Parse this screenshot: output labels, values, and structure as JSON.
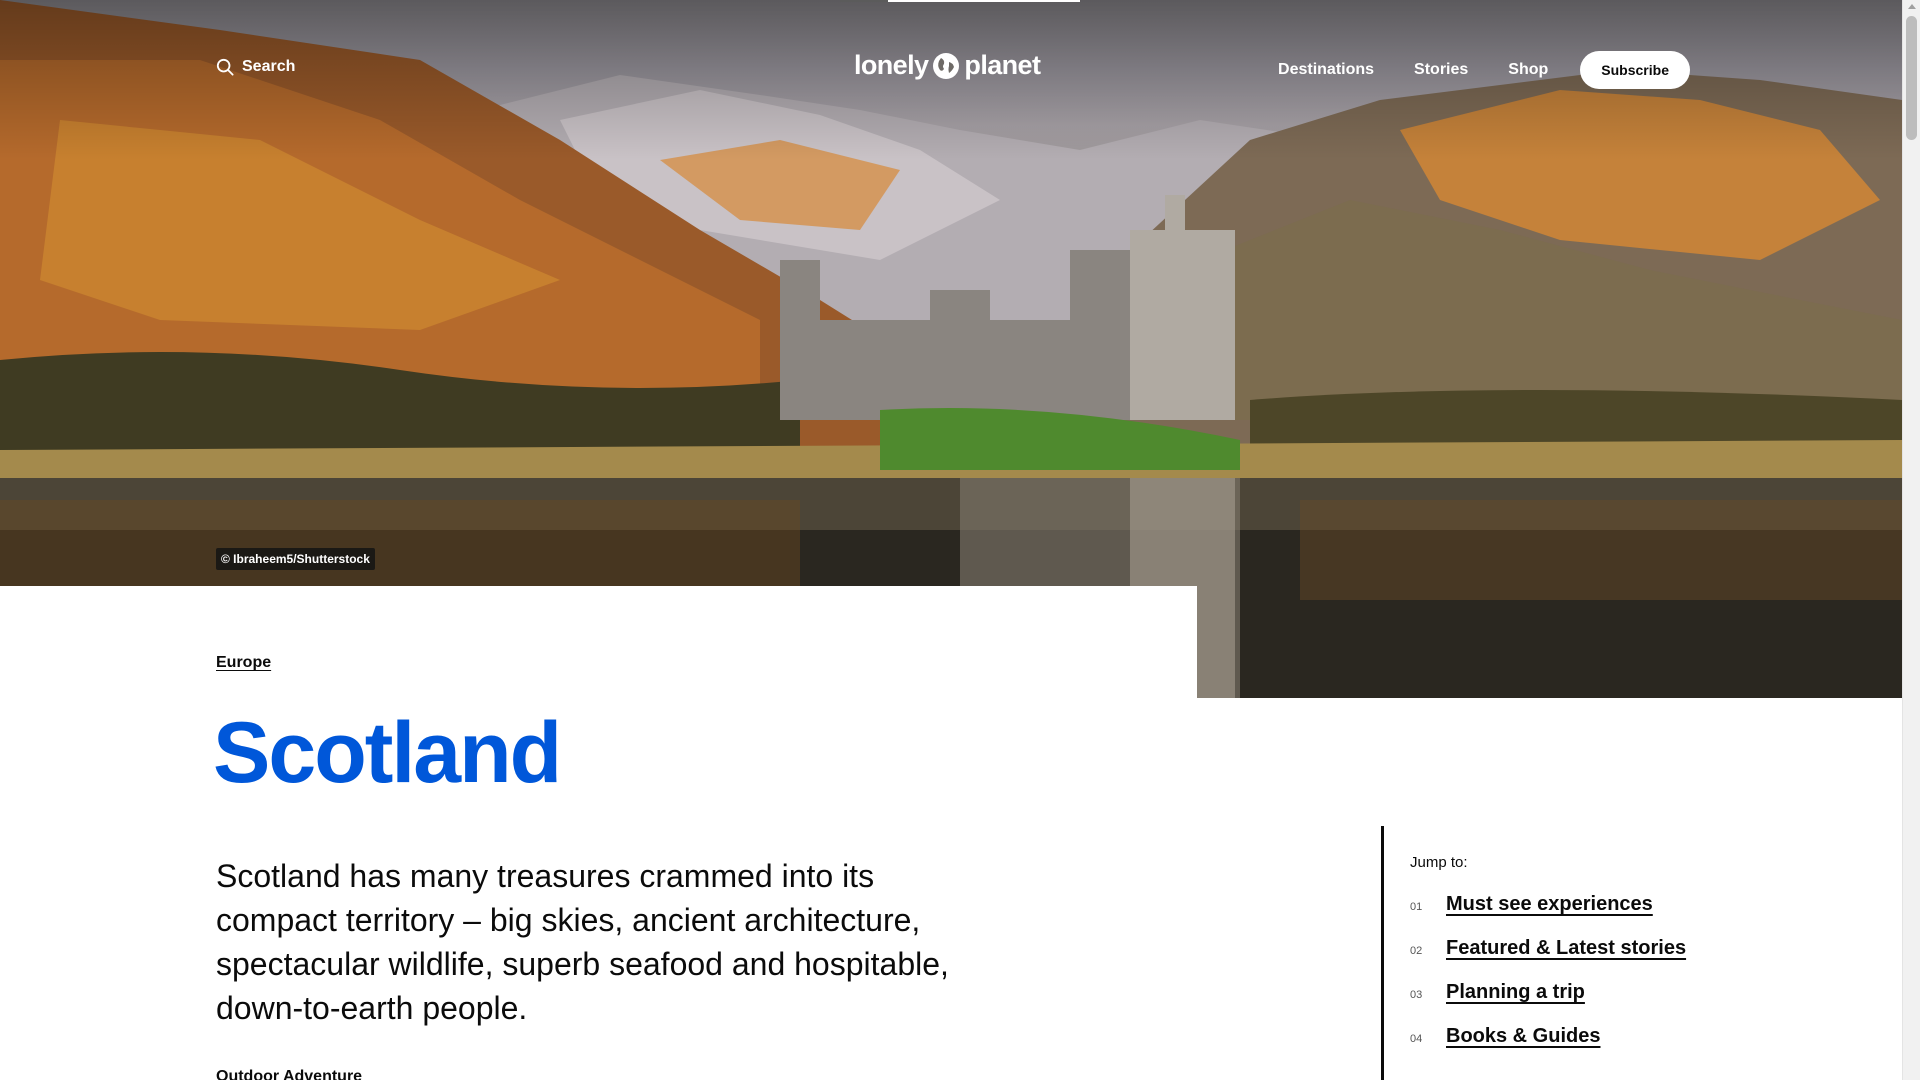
{
  "header": {
    "search_label": "Search",
    "logo_left": "lonely",
    "logo_right": "planet",
    "nav": [
      "Destinations",
      "Stories",
      "Shop"
    ],
    "subscribe_label": "Subscribe"
  },
  "hero": {
    "photo_credit": "© Ibraheem5/Shutterstock",
    "slide_progress": 0.8
  },
  "main": {
    "breadcrumb": "Europe",
    "title": "Scotland",
    "intro": "Scotland has many treasures crammed into its compact territory – big skies, ancient architecture, spectacular wildlife, superb seafood and hospitable, down-to-earth people.",
    "next_section": "Outdoor Adventure"
  },
  "jump_to": {
    "label": "Jump to:",
    "items": [
      {
        "num": "01",
        "label": "Must see experiences"
      },
      {
        "num": "02",
        "label": "Featured & Latest stories"
      },
      {
        "num": "03",
        "label": "Planning a trip"
      },
      {
        "num": "04",
        "label": "Books & Guides"
      }
    ]
  },
  "colors": {
    "title_blue": "#0057d9",
    "text": "#0b0b0b",
    "white": "#ffffff"
  },
  "icons": [
    "search-icon",
    "globe-icon"
  ]
}
